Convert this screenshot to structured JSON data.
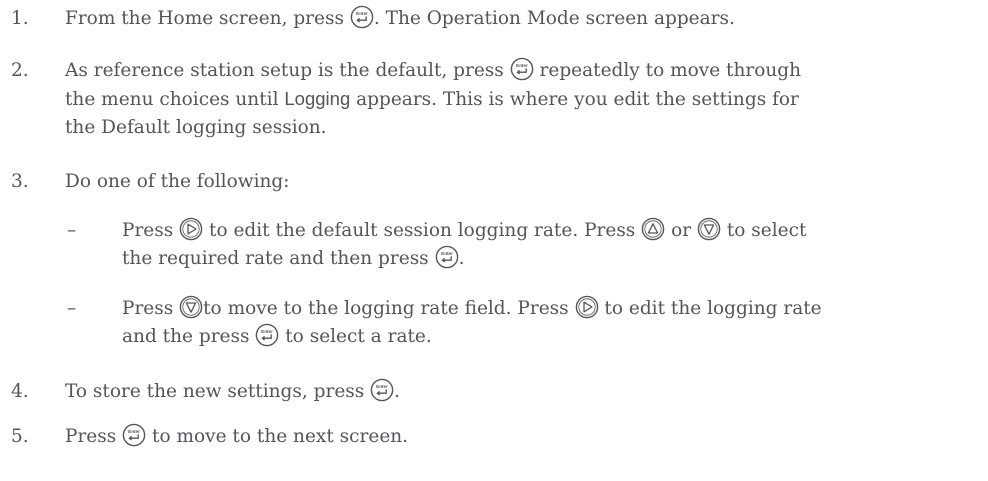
{
  "steps": {
    "s1": {
      "number": "1.",
      "parts": [
        "From the Home screen, press",
        ". The Operation Mode screen appears."
      ]
    },
    "s2": {
      "number": "2.",
      "parts": [
        "As reference station setup is the default, press",
        "repeatedly to move through",
        "the menu choices until",
        "Logging",
        "appears. This is where you edit the settings for",
        "the Default logging session."
      ]
    },
    "s3": {
      "number": "3.",
      "parts": [
        "Do one of the following:"
      ]
    },
    "sub1": {
      "marker": "–",
      "parts": [
        "Press",
        "to edit the default session logging rate. Press",
        "or",
        "to select",
        "the required rate and then press",
        "."
      ]
    },
    "sub2": {
      "marker": "–",
      "parts": [
        "Press",
        "to move to the logging rate field. Press",
        "to edit the logging rate",
        "and the press",
        "to select a rate."
      ]
    },
    "s4": {
      "number": "4.",
      "parts": [
        "To store the new settings, press",
        "."
      ]
    },
    "s5": {
      "number": "5.",
      "parts": [
        "Press",
        "to move to the next screen."
      ]
    }
  },
  "icons": {
    "enter_label": "Enter",
    "enter": "enter-key-icon",
    "right": "right-arrow-key-icon",
    "up": "up-arrow-key-icon",
    "down": "down-arrow-key-icon"
  },
  "colors": {
    "text": "#555459",
    "icon_stroke": "#555459"
  }
}
